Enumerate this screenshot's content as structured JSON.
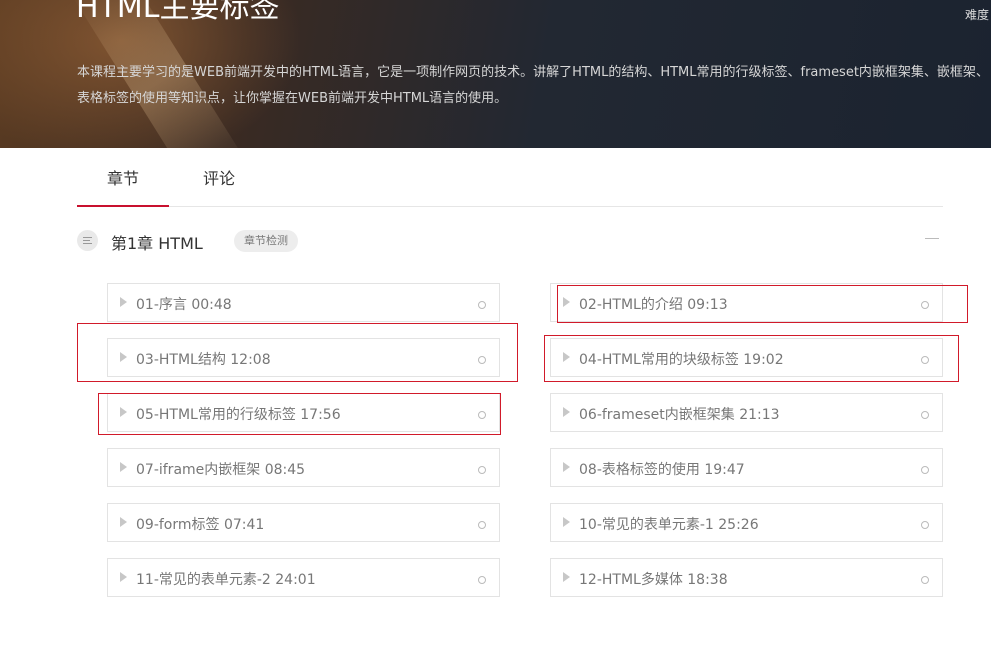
{
  "hero": {
    "title": "HTML主要标签",
    "side_label": "难度",
    "description": "本课程主要学习的是WEB前端开发中的HTML语言，它是一项制作网页的技术。讲解了HTML的结构、HTML常用的行级标签、frameset内嵌框架集、嵌框架、表格标签的使用等知识点，让你掌握在WEB前端开发中HTML语言的使用。"
  },
  "tabs": [
    {
      "label": "章节",
      "active": true
    },
    {
      "label": "评论",
      "active": false
    }
  ],
  "chapter": {
    "title": "第1章 HTML",
    "badge": "章节检测",
    "icon": "list-icon",
    "collapse_icon": "collapse-minus-icon"
  },
  "lessons": [
    {
      "label": "01-序言 00:48"
    },
    {
      "label": "02-HTML的介绍 09:13"
    },
    {
      "label": "03-HTML结构 12:08"
    },
    {
      "label": "04-HTML常用的块级标签 19:02"
    },
    {
      "label": "05-HTML常用的行级标签 17:56"
    },
    {
      "label": "06-frameset内嵌框架集 21:13"
    },
    {
      "label": "07-iframe内嵌框架 08:45"
    },
    {
      "label": "08-表格标签的使用 19:47"
    },
    {
      "label": "09-form标签 07:41"
    },
    {
      "label": "10-常见的表单元素-1 25:26"
    },
    {
      "label": "11-常见的表单元素-2 24:01"
    },
    {
      "label": "12-HTML多媒体 18:38"
    }
  ],
  "colors": {
    "accent": "#c8102e",
    "highlight_box": "#d11a2a"
  }
}
